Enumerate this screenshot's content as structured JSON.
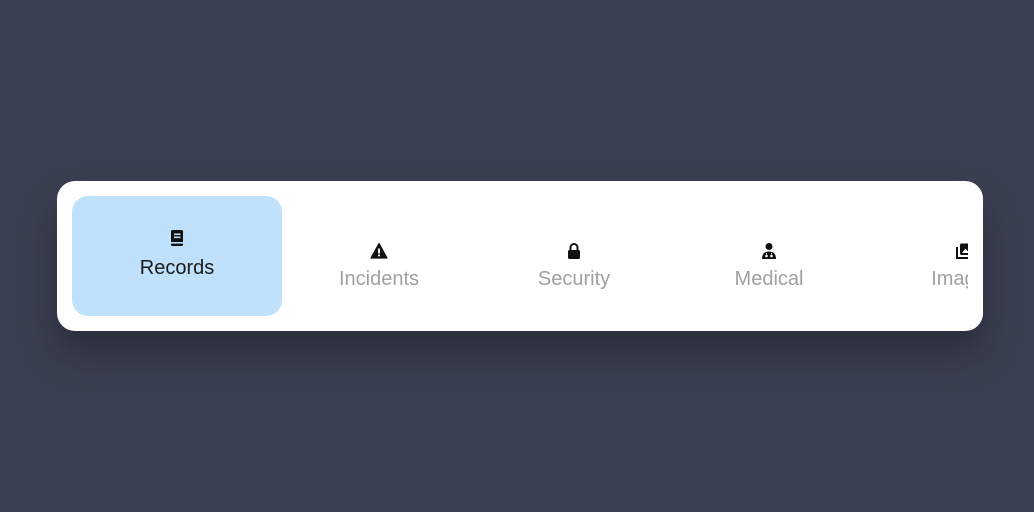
{
  "tabs": [
    {
      "label": "Records",
      "icon": "book-icon",
      "active": true
    },
    {
      "label": "Incidents",
      "icon": "warning-icon",
      "active": false
    },
    {
      "label": "Security",
      "icon": "lock-icon",
      "active": false
    },
    {
      "label": "Medical",
      "icon": "doctor-icon",
      "active": false
    },
    {
      "label": "Images",
      "icon": "images-icon",
      "active": false
    }
  ],
  "colors": {
    "background": "#3b4052",
    "card": "#ffffff",
    "active_tab": "#bfe1fb",
    "active_text": "#1b1b1b",
    "inactive_text": "#a0a0a0"
  }
}
